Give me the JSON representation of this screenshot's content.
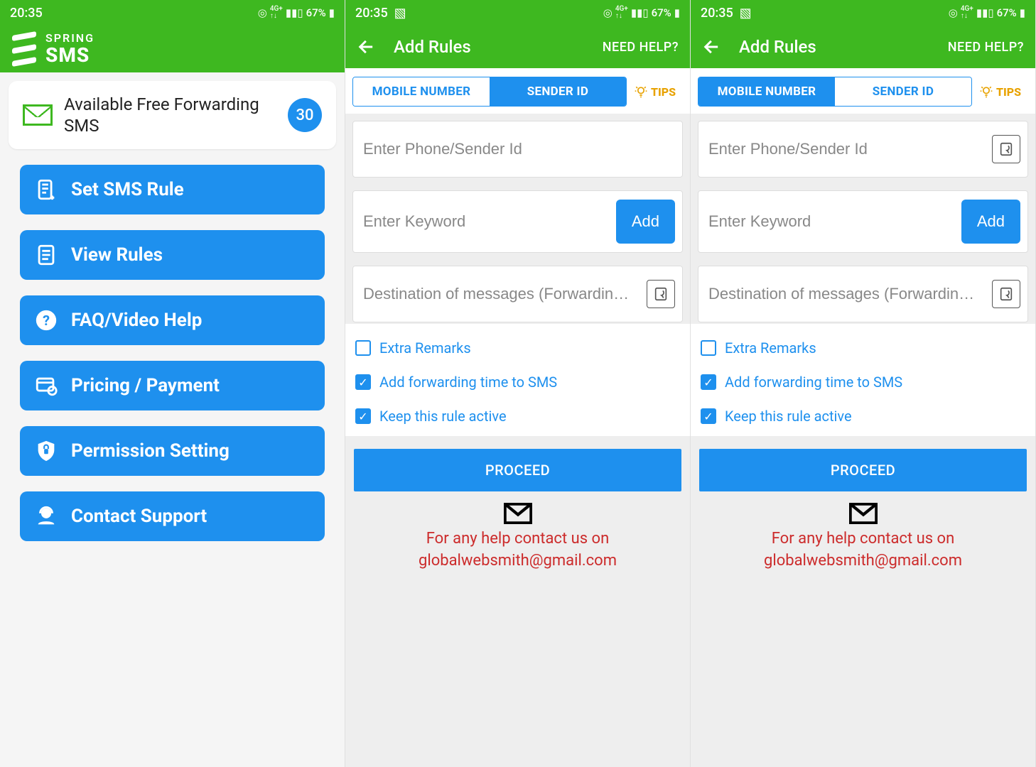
{
  "status": {
    "time": "20:35",
    "battery": "67%"
  },
  "brand": {
    "line1": "SPRING",
    "line2": "SMS"
  },
  "screen1": {
    "card_text": "Available Free Forwarding SMS",
    "card_count": "30",
    "menu": [
      "Set SMS Rule",
      "View Rules",
      "FAQ/Video Help",
      "Pricing / Payment",
      "Permission Setting",
      "Contact Support"
    ]
  },
  "addrules": {
    "title": "Add Rules",
    "help": "NEED HELP?",
    "tab_mobile": "MOBILE NUMBER",
    "tab_sender": "SENDER ID",
    "tips": "TIPS",
    "ph_phone": "Enter Phone/Sender Id",
    "ph_keyword": "Enter Keyword",
    "add": "Add",
    "ph_dest": "Destination of messages (Forwardin…",
    "chk_remarks": "Extra Remarks",
    "chk_time": "Add forwarding time to SMS",
    "chk_active": "Keep this rule active",
    "proceed": "PROCEED",
    "footer1": "For any help contact us on",
    "footer2": "globalwebsmith@gmail.com"
  }
}
